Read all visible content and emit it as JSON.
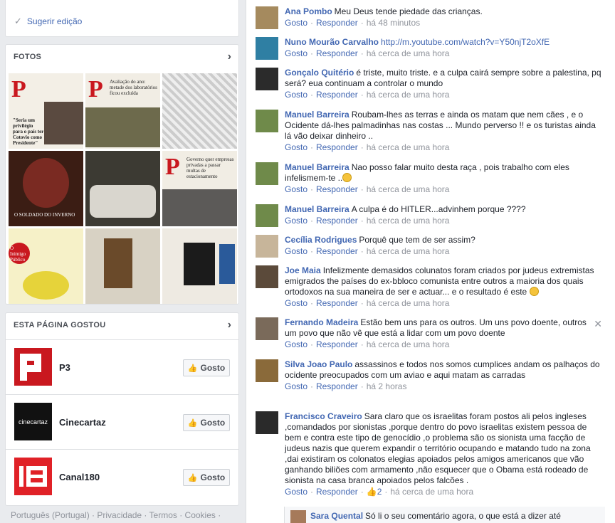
{
  "sidebar": {
    "suggest_edit": "Sugerir edição",
    "photos_title": "FOTOS",
    "likes_title": "ESTA PÁGINA GOSTOU",
    "pages": [
      {
        "name": "P3",
        "button": "Gosto"
      },
      {
        "name": "Cinecartaz",
        "button": "Gosto",
        "logo_text": "cinecartaz"
      },
      {
        "name": "Canal180",
        "button": "Gosto"
      }
    ],
    "footer": "Português (Portugal) · Privacidade · Termos · Cookies ·"
  },
  "photos": [
    {
      "logo": "P",
      "text": "\"Seria um privilégio para o país ter Cotovio como Presidente\""
    },
    {
      "logo": "P",
      "text": "Avaliação do ano: metade dos laboratórios ficou excluída"
    },
    {
      "logo": "",
      "text": "Governo quer empresas"
    },
    {
      "logo": "",
      "text": "O SOLDADO DO INVERNO"
    },
    {
      "logo": "",
      "text": ""
    },
    {
      "logo": "P",
      "text": "Governo quer empresas privadas a passar multas de estacionamento"
    },
    {
      "logo": "",
      "text": "O Inimigo Público"
    },
    {
      "logo": "",
      "text": ""
    },
    {
      "logo": "",
      "text": ""
    }
  ],
  "comments": [
    {
      "author": "Ana Pombo",
      "text": "Meu Deus tende piedade das crianças.",
      "time": "há 48 minutos"
    },
    {
      "author": "Nuno Mourão Carvalho",
      "text": "http://m.youtube.com/watch?v=Y50njT2oXfE",
      "time": "há cerca de uma hora"
    },
    {
      "author": "Gonçalo Quitério",
      "text": "é triste, muito triste. e a culpa cairá sempre sobre a palestina, pq será? eua continuam a controlar o mundo",
      "time": "há cerca de uma hora"
    },
    {
      "author": "Manuel Barreira",
      "text": "Roubam-lhes as terras e ainda os matam que nem cães , e o Ocidente dá-lhes palmadinhas nas costas ... Mundo perverso !! e os turistas ainda lá vão deixar dinheiro ..",
      "time": "há cerca de uma hora"
    },
    {
      "author": "Manuel Barreira",
      "text": "Nao posso falar muito desta raça , pois trabalho com eles infelismem-te ..",
      "time": "há cerca de uma hora"
    },
    {
      "author": "Manuel Barreira",
      "text": "A culpa é do HITLER...advinhem porque ????",
      "time": "há cerca de uma hora"
    },
    {
      "author": "Cecília Rodrigues",
      "text": "Porquê que tem de ser assim?",
      "time": "há cerca de uma hora"
    },
    {
      "author": "Joe Maia",
      "text": "Infelizmente demasidos colunatos foram criados por judeus extremistas emigrados the países do ex-bbloco comunista entre outros a maioria dos quais ortodoxos na sua maneira de ser e actuar... e o resultado é este",
      "time": "há cerca de uma hora"
    },
    {
      "author": "Fernando Madeira",
      "text": "Estão bem uns para os outros. Um uns povo doente, outros um povo que não vê que está a lidar com um povo doente",
      "time": "há cerca de uma hora"
    },
    {
      "author": "Silva Joao Paulo",
      "text": "assassinos e todos nos somos cumplices andam os palhaços do ocidente preocupados com um aviao e aqui matam as carradas",
      "time": "há 2 horas"
    },
    {
      "author": "Francisco Craveiro",
      "text": "Sara claro que os israelitas foram postos ali pelos ingleses ,comandados por sionistas ,porque dentro do povo israelitas existem pessoa de bem e contra este tipo de genocídio ,o problema são os sionista uma facção de judeus nazis que querem expandir o território ocupando e matando tudo na zona ,dai existiram os colonatos elegias apoiados pelos amigos americanos que vão ganhando biliões com armamento ,não esquecer que o Obama está rodeado de sionista na casa branca apoiados pelos falcões .",
      "time": "há cerca de uma hora",
      "likes": "2"
    }
  ],
  "reply": {
    "author": "Sara Quental",
    "text": "Só li o seu comentário agora, o que está a dizer até"
  },
  "labels": {
    "like": "Gosto",
    "reply": "Responder",
    "sep": "·"
  },
  "colors": {
    "link": "#4267b2",
    "muted": "#90949c",
    "brand_red": "#c9181f"
  }
}
